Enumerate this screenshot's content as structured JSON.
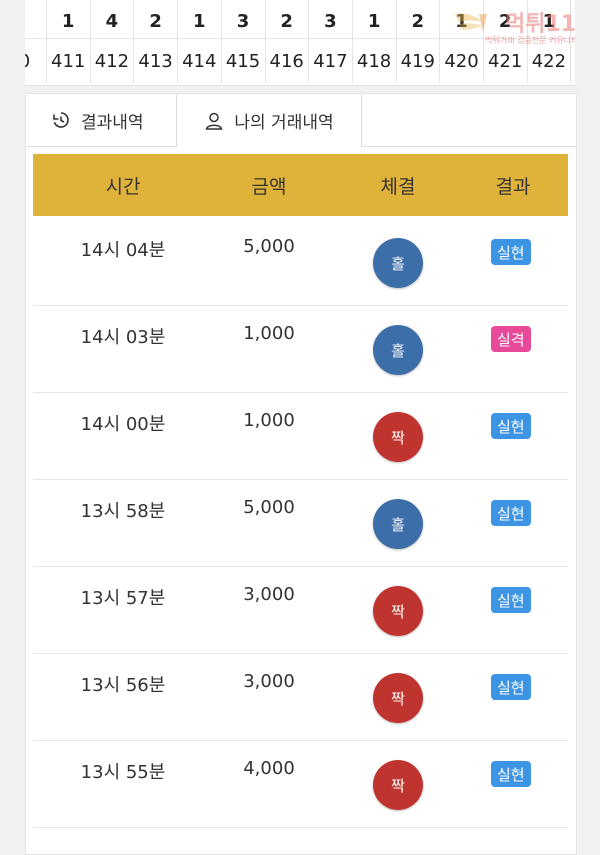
{
  "result_grid": {
    "top_row": [
      "",
      "1",
      "4",
      "2",
      "1",
      "3",
      "2",
      "3",
      "1",
      "2",
      "1",
      "2",
      "1"
    ],
    "round_numbers": [
      "0",
      "411",
      "412",
      "413",
      "414",
      "415",
      "416",
      "417",
      "418",
      "419",
      "420",
      "421",
      "422"
    ]
  },
  "watermark": {
    "title": "먹튀119",
    "subtitle": "먹튀거래 검증전문 커뮤니티"
  },
  "tabs": [
    {
      "label": "결과내역",
      "icon": "history-icon",
      "active": false
    },
    {
      "label": "나의 거래내역",
      "icon": "user-icon",
      "active": true
    }
  ],
  "table": {
    "headers": [
      "시간",
      "금액",
      "체결",
      "결과"
    ],
    "rows": [
      {
        "time": "14시 04분",
        "amount": "5,000",
        "pick": "홀",
        "result": "실현"
      },
      {
        "time": "14시 03분",
        "amount": "1,000",
        "pick": "홀",
        "result": "실격"
      },
      {
        "time": "14시 00분",
        "amount": "1,000",
        "pick": "짝",
        "result": "실현"
      },
      {
        "time": "13시 58분",
        "amount": "5,000",
        "pick": "홀",
        "result": "실현"
      },
      {
        "time": "13시 57분",
        "amount": "3,000",
        "pick": "짝",
        "result": "실현"
      },
      {
        "time": "13시 56분",
        "amount": "3,000",
        "pick": "짝",
        "result": "실현"
      },
      {
        "time": "13시 55분",
        "amount": "4,000",
        "pick": "짝",
        "result": "실현"
      }
    ]
  },
  "colors": {
    "header_bg": "#dfb23a",
    "odd_ball": "#3c6eaa",
    "even_ball": "#c0342f",
    "win_badge": "#3e94e4",
    "lose_badge": "#e84a9a"
  }
}
